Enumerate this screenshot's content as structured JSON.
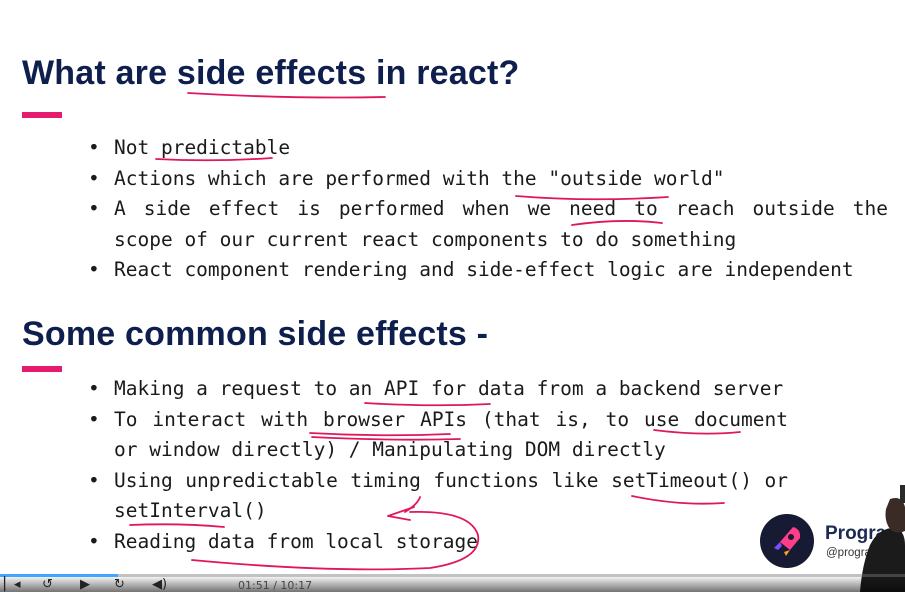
{
  "slide": {
    "section1": {
      "heading": "What are side effects in react?",
      "bullets": [
        "Not predictable",
        "Actions which are performed with the \"outside world\"",
        "A side effect is performed when we need to reach outside the scope of our current react components to do something",
        "React component rendering and side-effect logic are independent"
      ]
    },
    "section2": {
      "heading": "Some common side effects -",
      "bullets": [
        "Making a request to an API for data from a backend server",
        "To interact with browser APIs (that is, to use document or window directly) / Manipulating DOM directly",
        "Using unpredictable timing functions like setTimeout() or setInterval()",
        "Reading data from local storage"
      ]
    },
    "colors": {
      "heading": "#0f1f4d",
      "accent": "#e61b6d",
      "annotation": "#e0165f"
    }
  },
  "brand": {
    "name": "Program",
    "handle": "@programm",
    "logo_icon": "rocket-logo-icon"
  },
  "player": {
    "progress_fraction": 0.13,
    "time_display": "01:51 / 10:17",
    "progress_color": "#3ea6ff"
  }
}
